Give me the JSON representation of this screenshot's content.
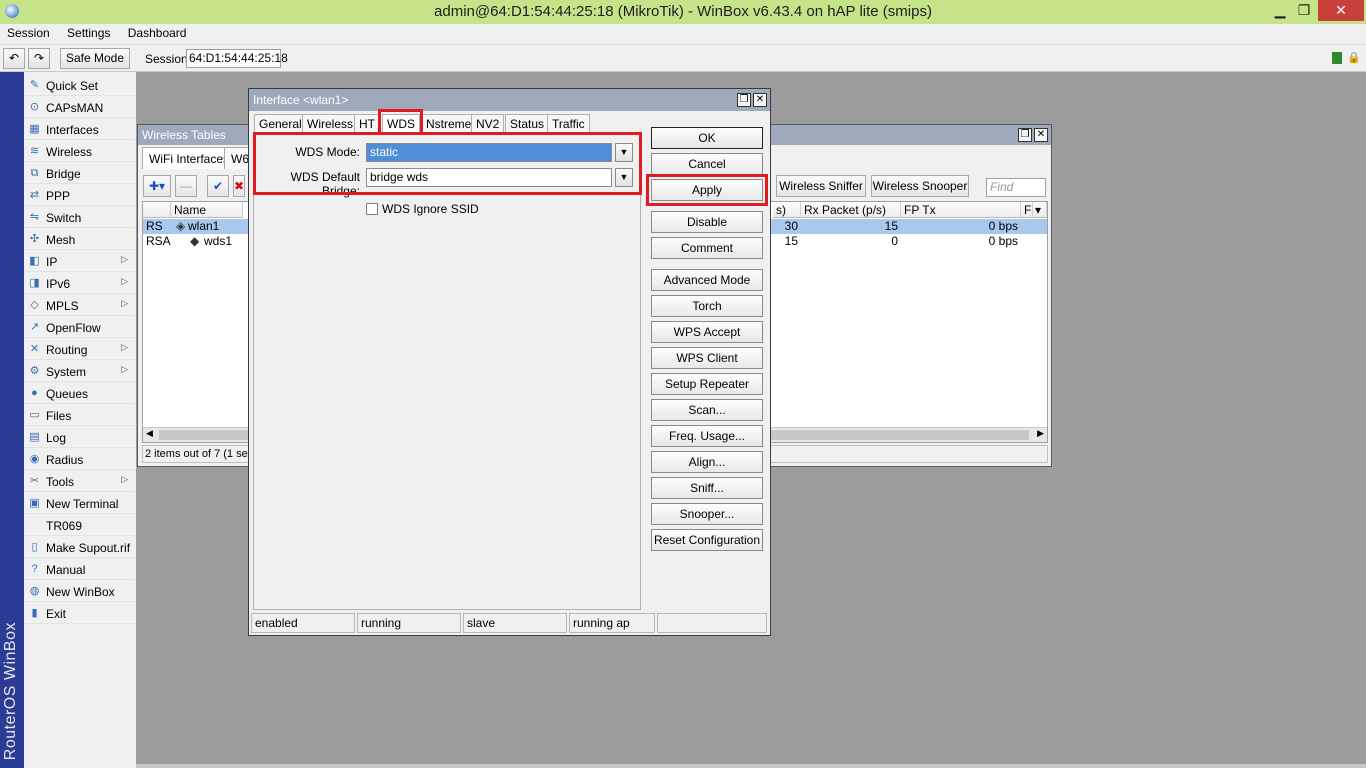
{
  "window": {
    "title": "admin@64:D1:54:44:25:18 (MikroTik) - WinBox v6.43.4 on hAP lite (smips)",
    "controls": {
      "minimize": "▁",
      "maximize": "❐",
      "close": "✕"
    }
  },
  "menu": [
    "Session",
    "Settings",
    "Dashboard"
  ],
  "toolbar": {
    "undo_icon": "↶",
    "redo_icon": "↷",
    "safe_mode_label": "Safe Mode",
    "session_label": "Session:",
    "session_value": "64:D1:54:44:25:18",
    "lock_icon": "🔒"
  },
  "brand": "RouterOS WinBox",
  "sidebar": {
    "items": [
      {
        "label": "Quick Set",
        "icon": "✎",
        "submenu": false
      },
      {
        "label": "CAPsMAN",
        "icon": "⊙",
        "submenu": false
      },
      {
        "label": "Interfaces",
        "icon": "▦",
        "submenu": false
      },
      {
        "label": "Wireless",
        "icon": "≋",
        "submenu": false
      },
      {
        "label": "Bridge",
        "icon": "⧉",
        "submenu": false
      },
      {
        "label": "PPP",
        "icon": "⇄",
        "submenu": false
      },
      {
        "label": "Switch",
        "icon": "⇋",
        "submenu": false
      },
      {
        "label": "Mesh",
        "icon": "✣",
        "submenu": false
      },
      {
        "label": "IP",
        "icon": "◧",
        "submenu": true
      },
      {
        "label": "IPv6",
        "icon": "◨",
        "submenu": true
      },
      {
        "label": "MPLS",
        "icon": "◇",
        "submenu": true
      },
      {
        "label": "OpenFlow",
        "icon": "↗",
        "submenu": false
      },
      {
        "label": "Routing",
        "icon": "✕",
        "submenu": true
      },
      {
        "label": "System",
        "icon": "⚙",
        "submenu": true
      },
      {
        "label": "Queues",
        "icon": "●",
        "submenu": false
      },
      {
        "label": "Files",
        "icon": "▭",
        "submenu": false
      },
      {
        "label": "Log",
        "icon": "▤",
        "submenu": false
      },
      {
        "label": "Radius",
        "icon": "◉",
        "submenu": false
      },
      {
        "label": "Tools",
        "icon": "✂",
        "submenu": true
      },
      {
        "label": "New Terminal",
        "icon": "▣",
        "submenu": false
      },
      {
        "label": "TR069",
        "icon": "",
        "submenu": false
      },
      {
        "label": "Make Supout.rif",
        "icon": "▯",
        "submenu": false
      },
      {
        "label": "Manual",
        "icon": "?",
        "submenu": false
      },
      {
        "label": "New WinBox",
        "icon": "◍",
        "submenu": false
      },
      {
        "label": "Exit",
        "icon": "▮",
        "submenu": false
      }
    ],
    "arrow": "▷"
  },
  "wireless_tables": {
    "title": "Wireless Tables",
    "tabs": [
      "WiFi Interfaces",
      "W6"
    ],
    "buttons": {
      "add": "✚▾",
      "remove": "—",
      "enable": "✔",
      "disable": "✖",
      "sniffer": "Wireless Sniffer",
      "snooper": "Wireless Snooper"
    },
    "find_placeholder": "Find",
    "columns": {
      "flag": "",
      "name": "Name",
      "tx_packet": "s)",
      "rx_packet": "Rx Packet (p/s)",
      "fp_tx": "FP Tx",
      "fp_rx": "F",
      "menu": "▾"
    },
    "rows": [
      {
        "flag": "RS",
        "name": "wlan1",
        "icon": "◈",
        "tx_packet": "30",
        "rx_packet": "15",
        "fp_tx": "0 bps"
      },
      {
        "flag": "RSA",
        "name": "wds1",
        "icon": "◆",
        "tx_packet": "15",
        "rx_packet": "0",
        "fp_tx": "0 bps"
      }
    ],
    "scroll_left": "◀",
    "scroll_right": "▶",
    "status": "2 items out of 7 (1 sele"
  },
  "dialog": {
    "title": "Interface <wlan1>",
    "tabs": [
      "General",
      "Wireless",
      "HT",
      "WDS",
      "Nstreme",
      "NV2",
      "Status",
      "Traffic"
    ],
    "active_tab": "WDS",
    "fields": {
      "wds_mode_label": "WDS Mode:",
      "wds_mode_value": "static",
      "wds_bridge_label": "WDS Default Bridge:",
      "wds_bridge_value": "bridge wds",
      "ignore_ssid_label": "WDS Ignore SSID",
      "dropdown_icon": "▼"
    },
    "actions": [
      "OK",
      "Cancel",
      "Apply",
      "Disable",
      "Comment",
      "Advanced Mode",
      "Torch",
      "WPS Accept",
      "WPS Client",
      "Setup Repeater",
      "Scan...",
      "Freq. Usage...",
      "Align...",
      "Sniff...",
      "Snooper...",
      "Reset Configuration"
    ],
    "status": [
      "enabled",
      "running",
      "slave",
      "running ap",
      ""
    ],
    "controls": {
      "maximize": "❐",
      "close": "✕"
    }
  },
  "colors": {
    "titlebar": "#c5e48a",
    "brand_strip": "#2a3c95",
    "highlight": "#e01b24",
    "selected_row": "#a8c8ee",
    "selected_field": "#4f8ed9"
  }
}
